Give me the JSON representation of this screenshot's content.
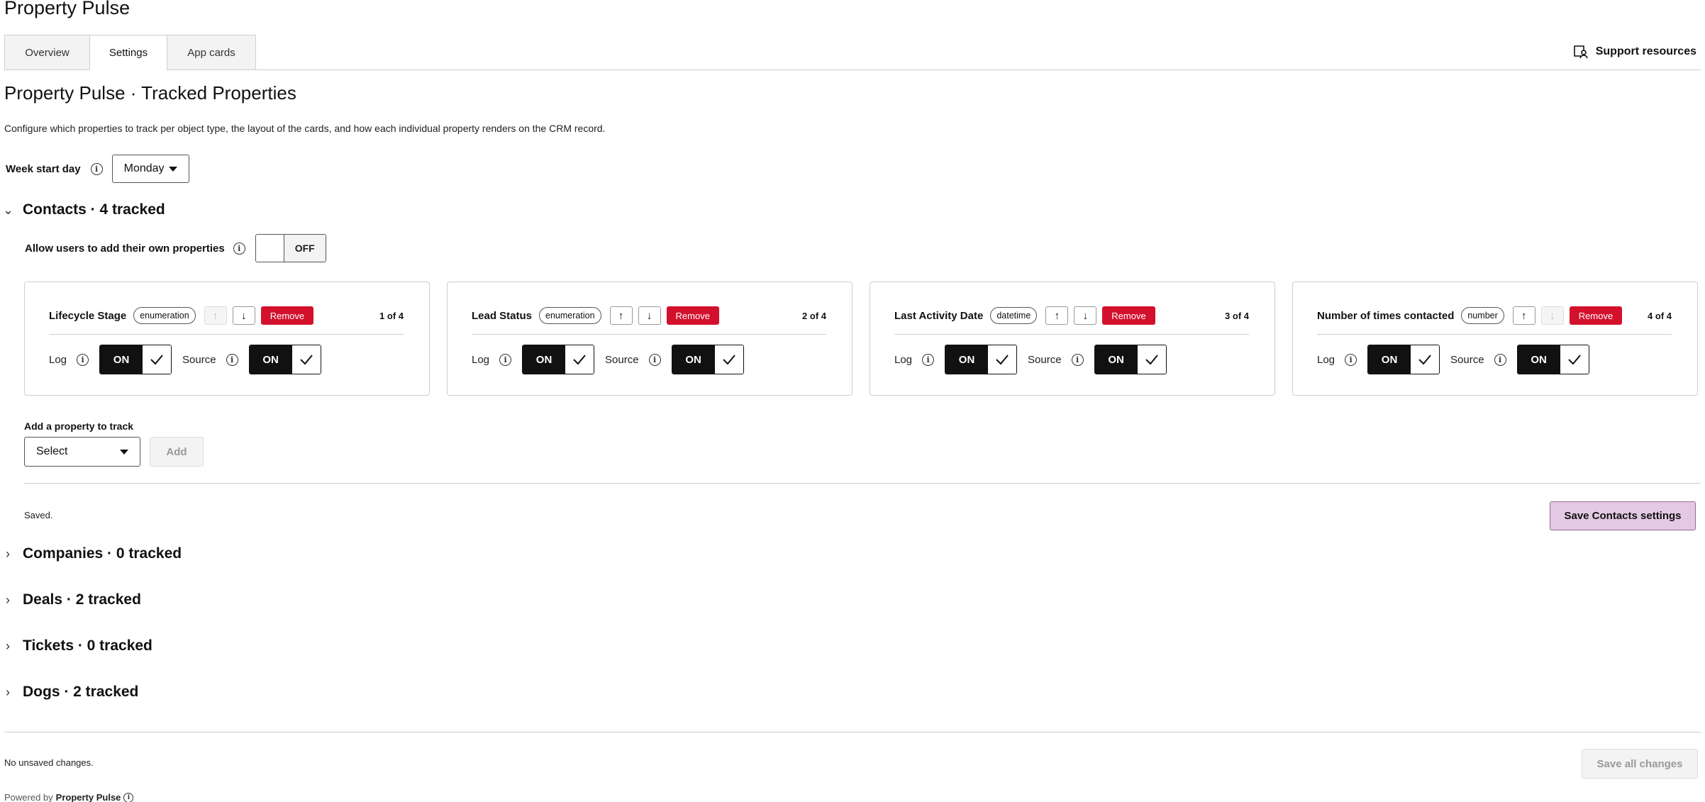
{
  "app": {
    "title": "Property Pulse"
  },
  "tabs": [
    {
      "label": "Overview"
    },
    {
      "label": "Settings"
    },
    {
      "label": "App cards"
    }
  ],
  "support": {
    "label": "Support resources"
  },
  "page": {
    "heading": "Property Pulse · Tracked Properties",
    "description": "Configure which properties to track per object type, the layout of the cards, and how each individual property renders on the CRM record."
  },
  "week_start": {
    "label": "Week start day",
    "value": "Monday"
  },
  "contacts": {
    "title": "Contacts · 4 tracked",
    "allow_label": "Allow users to add their own properties",
    "allow_state": "OFF",
    "cards": [
      {
        "name": "Lifecycle Stage",
        "type": "enumeration",
        "remove": "Remove",
        "position": "1 of 4",
        "log_label": "Log",
        "log_state": "ON",
        "source_label": "Source",
        "source_state": "ON"
      },
      {
        "name": "Lead Status",
        "type": "enumeration",
        "remove": "Remove",
        "position": "2 of 4",
        "log_label": "Log",
        "log_state": "ON",
        "source_label": "Source",
        "source_state": "ON"
      },
      {
        "name": "Last Activity Date",
        "type": "datetime",
        "remove": "Remove",
        "position": "3 of 4",
        "log_label": "Log",
        "log_state": "ON",
        "source_label": "Source",
        "source_state": "ON"
      },
      {
        "name": "Number of times contacted",
        "type": "number",
        "remove": "Remove",
        "position": "4 of 4",
        "log_label": "Log",
        "log_state": "ON",
        "source_label": "Source",
        "source_state": "ON"
      }
    ],
    "add_label": "Add a property to track",
    "select_placeholder": "Select",
    "add_button": "Add",
    "status": "Saved.",
    "save_button": "Save Contacts settings"
  },
  "sections": [
    {
      "title": "Companies · 0 tracked"
    },
    {
      "title": "Deals · 2 tracked"
    },
    {
      "title": "Tickets · 0 tracked"
    },
    {
      "title": "Dogs · 2 tracked"
    }
  ],
  "footer": {
    "status": "No unsaved changes.",
    "save_all": "Save all changes",
    "powered_prefix": "Powered by",
    "powered_brand": "Property Pulse"
  },
  "icons": {
    "up": "↑",
    "down": "↓",
    "check": "check-icon",
    "info": "info-icon",
    "support": "book-person-icon"
  },
  "colors": {
    "remove": "#d4112d",
    "toggle_on": "#111111",
    "save_contacts": "#e3c9e3"
  }
}
